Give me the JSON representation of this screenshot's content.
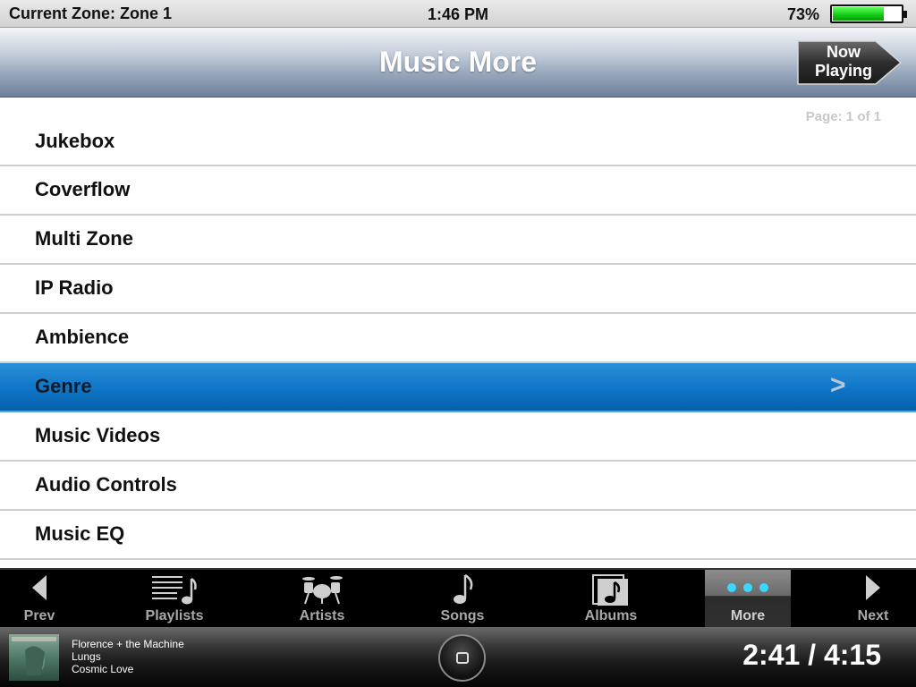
{
  "status": {
    "zone": "Current Zone: Zone 1",
    "time": "1:46 PM",
    "battery_pct": "73%",
    "battery_level": 0.73
  },
  "header": {
    "title": "Music More",
    "now_playing_label": "Now\nPlaying"
  },
  "page_indicator": "Page: 1 of 1",
  "menu": {
    "items": [
      {
        "label": "Jukebox"
      },
      {
        "label": "Coverflow"
      },
      {
        "label": "Multi Zone"
      },
      {
        "label": "IP Radio"
      },
      {
        "label": "Ambience"
      },
      {
        "label": "Genre",
        "selected": true
      },
      {
        "label": "Music Videos"
      },
      {
        "label": "Audio Controls"
      },
      {
        "label": "Music EQ"
      }
    ],
    "chevron": ">"
  },
  "tabs": [
    {
      "label": "Prev",
      "icon": "prev-arrow-icon"
    },
    {
      "label": "Playlists",
      "icon": "playlist-icon"
    },
    {
      "label": "Artists",
      "icon": "drums-icon"
    },
    {
      "label": "Songs",
      "icon": "music-note-icon"
    },
    {
      "label": "Albums",
      "icon": "album-icon"
    },
    {
      "label": "More",
      "icon": "more-dots-icon",
      "active": true
    },
    {
      "label": "Next",
      "icon": "next-arrow-icon"
    }
  ],
  "now_playing": {
    "artist": "Florence + the Machine",
    "album": "Lungs",
    "song": "Cosmic Love",
    "time": "2:41 / 4:15"
  },
  "colors": {
    "selection": "#1077c9",
    "more_dots": "#3ad7ff",
    "battery": "#12c812"
  }
}
